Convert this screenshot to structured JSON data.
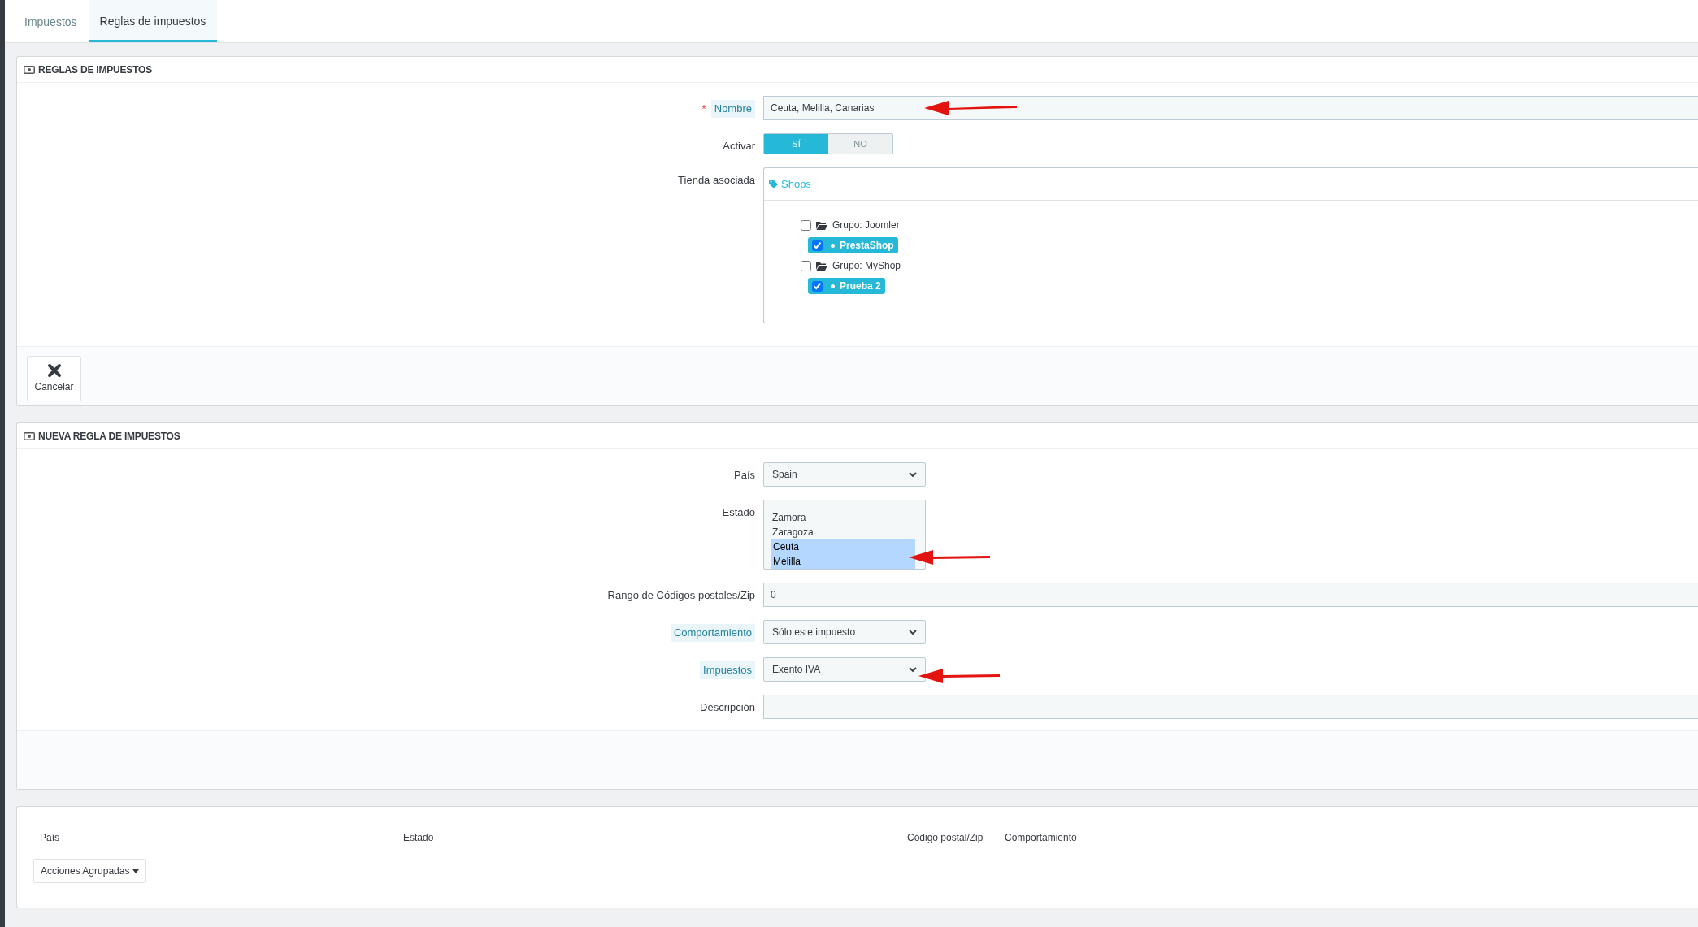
{
  "tabs": [
    {
      "label": "Impuestos",
      "selected": false
    },
    {
      "label": "Reglas de impuestos",
      "selected": true
    }
  ],
  "rule_panel": {
    "title": "REGLAS DE IMPUESTOS",
    "fields": [
      {
        "kind": "text",
        "label": "Nombre",
        "required_mark": "*",
        "help": true,
        "value": "Ceuta, Melilla, Canarias"
      },
      {
        "kind": "toggle",
        "label": "Activar",
        "help": false,
        "options": [
          {
            "label": "SÍ",
            "selected": true
          },
          {
            "label": "NO",
            "selected": false
          }
        ]
      },
      {
        "kind": "shops",
        "label": "Tienda asociada",
        "help": false,
        "heading": "Shops",
        "groups": [
          {
            "label": "Grupo: Joomler",
            "checked": false,
            "shops": [
              {
                "label": "PrestaShop",
                "checked": true
              }
            ]
          },
          {
            "label": "Grupo: MyShop",
            "checked": false,
            "shops": [
              {
                "label": "Prueba 2",
                "checked": true
              }
            ]
          }
        ]
      }
    ],
    "cancel_button": "Cancelar"
  },
  "new_rule_panel": {
    "title": "NUEVA REGLA DE IMPUESTOS",
    "fields": [
      {
        "kind": "select",
        "label": "País",
        "help": false,
        "value": "Spain"
      },
      {
        "kind": "listbox",
        "label": "Estado",
        "help": false,
        "options": [
          {
            "label": "Zamora",
            "selected": false
          },
          {
            "label": "Zaragoza",
            "selected": false
          },
          {
            "label": "Ceuta",
            "selected": true
          },
          {
            "label": "Melilla",
            "selected": true
          }
        ]
      },
      {
        "kind": "text",
        "label": "Rango de Códigos postales/Zip",
        "help": false,
        "value": "0"
      },
      {
        "kind": "select",
        "label": "Comportamiento",
        "help": true,
        "value": "Sólo este impuesto"
      },
      {
        "kind": "select",
        "label": "Impuestos",
        "help": true,
        "value": "Exento IVA"
      },
      {
        "kind": "text",
        "label": "Descripción",
        "help": false
      }
    ]
  },
  "rules_table": {
    "columns": [
      "País",
      "Estado",
      "Código postal/Zip",
      "Comportamiento"
    ],
    "bulk_button": "Acciones Agrupadas"
  }
}
